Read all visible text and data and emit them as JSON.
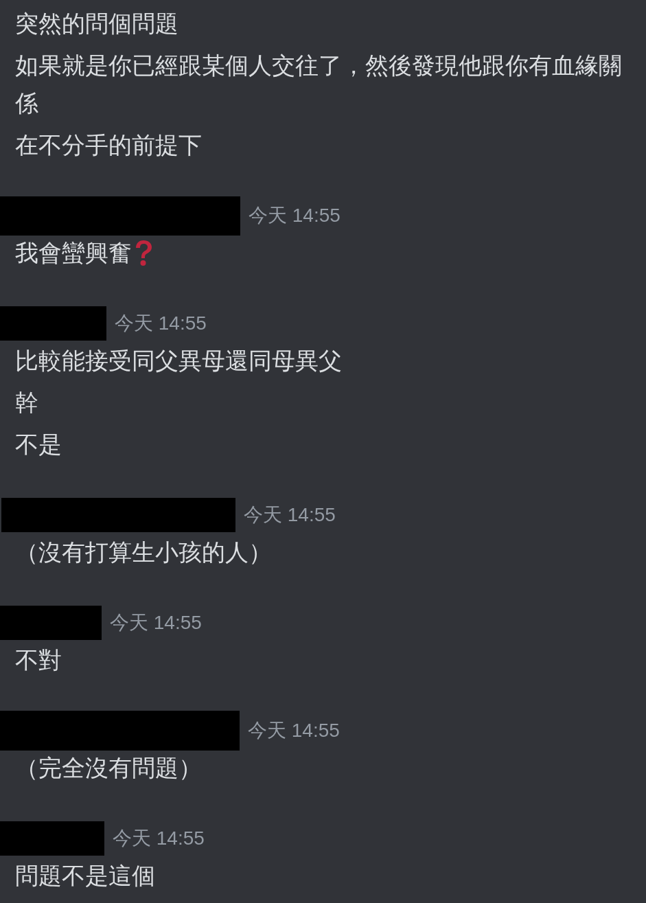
{
  "groups": [
    {
      "messages": [
        {
          "kind": "text",
          "text": "突然的問個問題"
        },
        {
          "kind": "text",
          "text": "如果就是你已經跟某個人交往了，然後發現他跟你有血緣關係"
        },
        {
          "kind": "text",
          "text": "在不分手的前提下"
        }
      ]
    },
    {
      "time": "今天 14:55",
      "messages": [
        {
          "kind": "text-icon",
          "text": "我會蠻興奮"
        }
      ]
    },
    {
      "time": "今天 14:55",
      "messages": [
        {
          "kind": "text",
          "text": "比較能接受同父異母還同母異父"
        },
        {
          "kind": "text",
          "text": "幹"
        },
        {
          "kind": "text",
          "text": "不是"
        }
      ]
    },
    {
      "time": "今天 14:55",
      "messages": [
        {
          "kind": "text",
          "text": "（沒有打算生小孩的人）"
        }
      ]
    },
    {
      "time": "今天 14:55",
      "messages": [
        {
          "kind": "text",
          "text": "不對"
        }
      ]
    },
    {
      "time": "今天 14:55",
      "messages": [
        {
          "kind": "text",
          "text": "（完全沒有問題）"
        }
      ]
    },
    {
      "time": "今天 14:55",
      "messages": [
        {
          "kind": "text",
          "text": "問題不是這個"
        }
      ]
    }
  ]
}
